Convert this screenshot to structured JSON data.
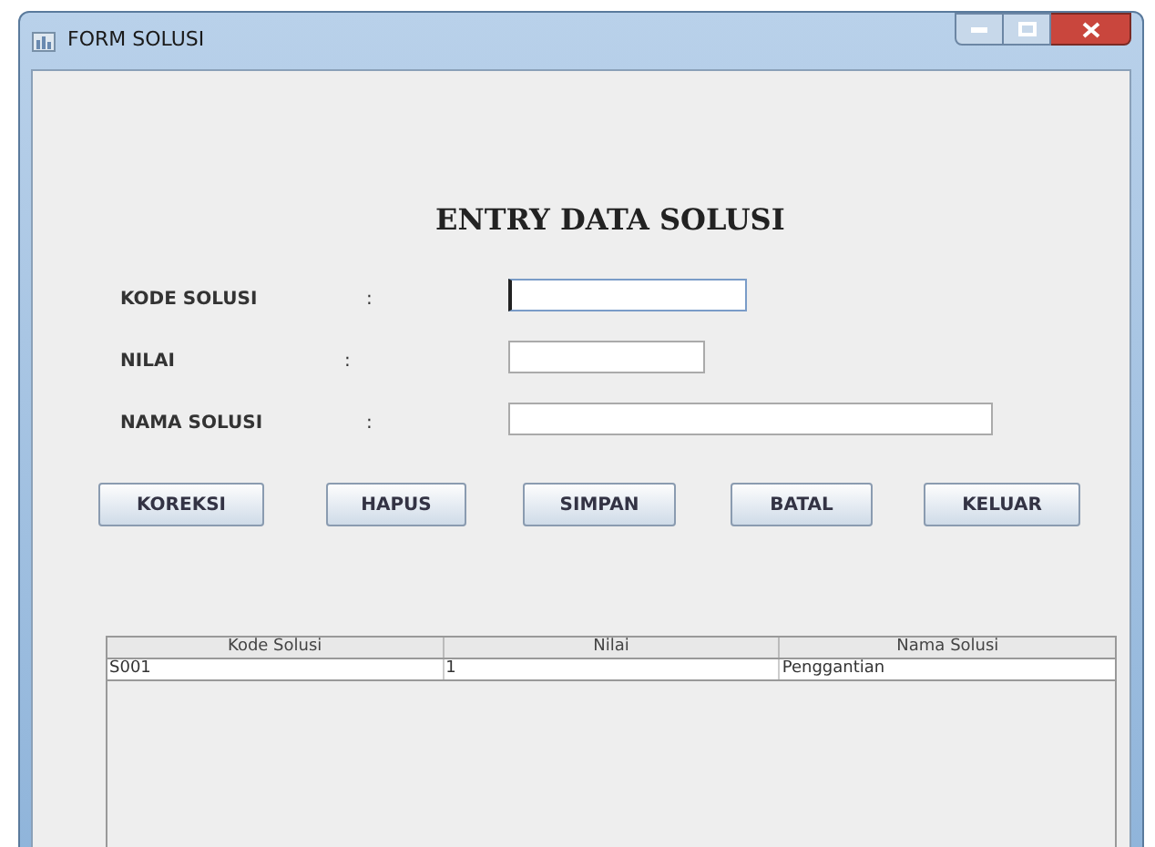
{
  "window": {
    "title": "FORM SOLUSI"
  },
  "heading": "ENTRY DATA SOLUSI",
  "fields": [
    {
      "label": "KODE SOLUSI",
      "colon": ":",
      "focused": true
    },
    {
      "label": "NILAI",
      "colon": ":",
      "focused": false
    },
    {
      "label": "NAMA SOLUSI",
      "colon": ":",
      "focused": false
    }
  ],
  "buttons": [
    "KOREKSI",
    "HAPUS",
    "SIMPAN",
    "BATAL",
    "KELUAR"
  ],
  "table": {
    "columns": [
      "Kode Solusi",
      "Nilai",
      "Nama Solusi"
    ],
    "rows": [
      [
        "S001",
        "1",
        "Penggantian"
      ]
    ]
  }
}
